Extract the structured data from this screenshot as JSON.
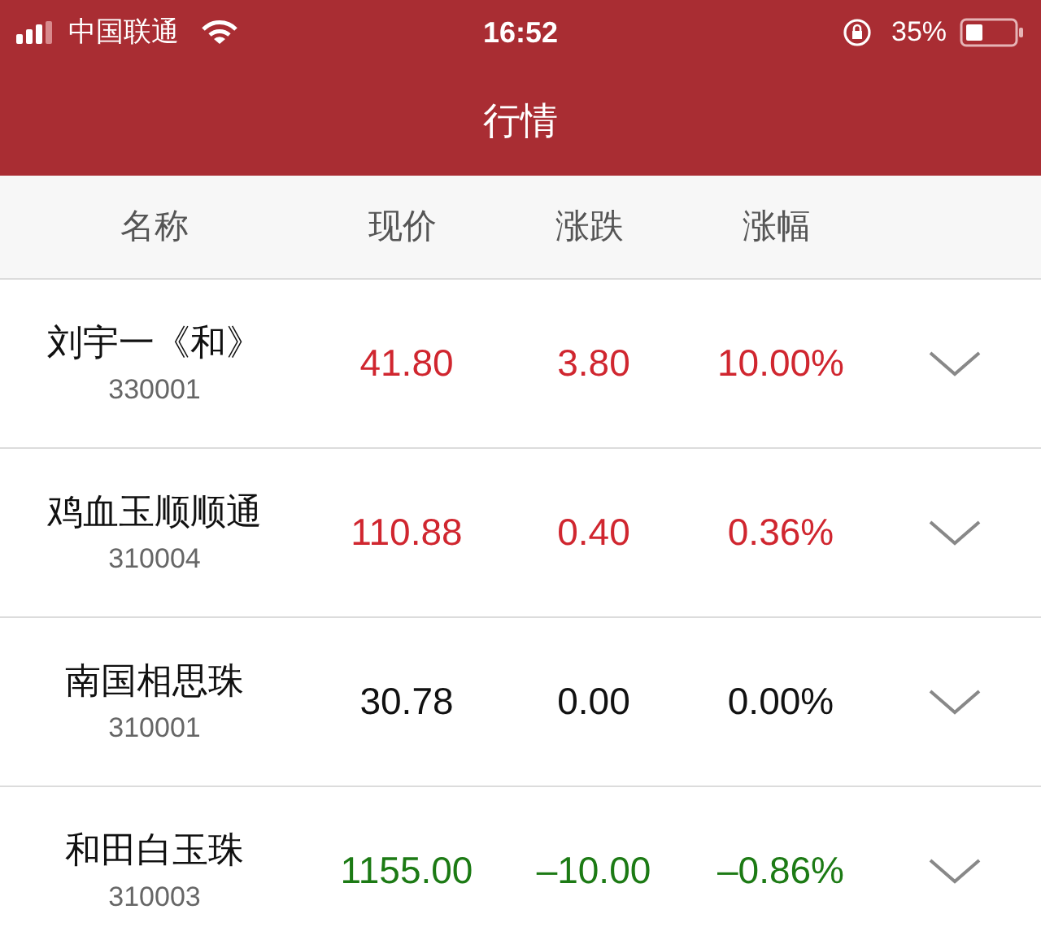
{
  "status_bar": {
    "carrier": "中国联通",
    "time": "16:52",
    "battery": "35%"
  },
  "title": "行情",
  "columns": [
    "名称",
    "现价",
    "涨跌",
    "涨幅"
  ],
  "rows": [
    {
      "name": "刘宇一《和》",
      "code": "330001",
      "price": "41.80",
      "change": "3.80",
      "percent": "10.00%",
      "color": "#d0262f"
    },
    {
      "name": "鸡血玉顺顺通",
      "code": "310004",
      "price": "110.88",
      "change": "0.40",
      "percent": "0.36%",
      "color": "#d0262f"
    },
    {
      "name": "南国相思珠",
      "code": "310001",
      "price": "30.78",
      "change": "0.00",
      "percent": "0.00%",
      "color": "#111111"
    },
    {
      "name": "和田白玉珠",
      "code": "310003",
      "price": "1155.00",
      "change": "–10.00",
      "percent": "–0.86%",
      "color": "#1c7a14"
    }
  ]
}
